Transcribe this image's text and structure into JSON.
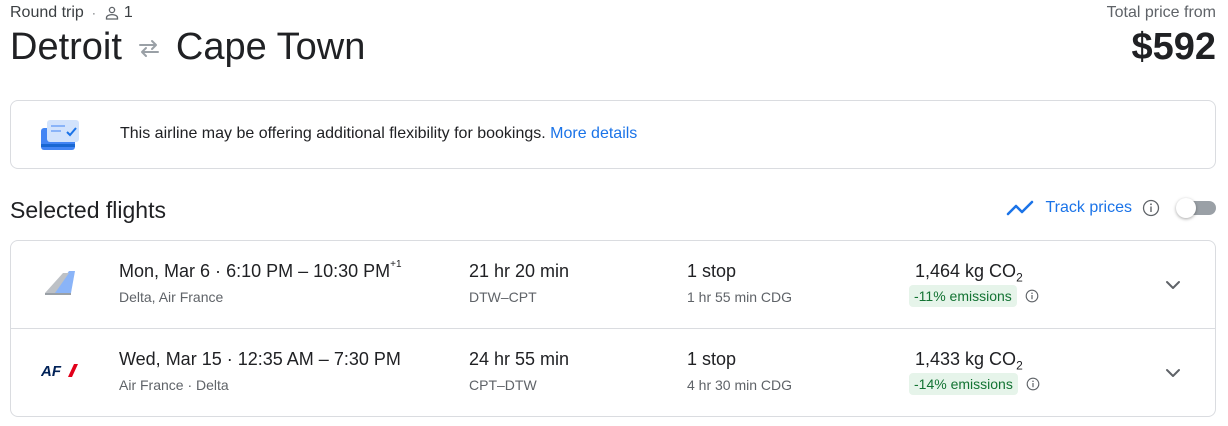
{
  "header": {
    "trip_type": "Round trip",
    "separator": "·",
    "passengers": "1",
    "origin": "Detroit",
    "destination": "Cape Town",
    "price_label": "Total price from",
    "price": "$592"
  },
  "notice": {
    "text": "This airline may be offering additional flexibility for bookings.",
    "link": "More details"
  },
  "section": {
    "title": "Selected flights",
    "track_label": "Track prices",
    "track_enabled": false
  },
  "flights": [
    {
      "date": "Mon, Mar 6",
      "dot": "·",
      "times": "6:10 PM – 10:30 PM",
      "day_offset": "+1",
      "airlines": "Delta, Air France",
      "duration": "21 hr 20 min",
      "airports": "DTW–CPT",
      "stops": "1 stop",
      "layover": "1 hr 55 min CDG",
      "co2_value": "1,464 kg CO",
      "co2_sub": "2",
      "emissions": "-11% emissions",
      "logo": "delta-logo"
    },
    {
      "date": "Wed, Mar 15",
      "dot": "·",
      "times": "12:35 AM – 7:30 PM",
      "day_offset": "",
      "airlines": "Air France · Delta",
      "duration": "24 hr 55 min",
      "airports": "CPT–DTW",
      "stops": "1 stop",
      "layover": "4 hr 30 min CDG",
      "co2_value": "1,433 kg CO",
      "co2_sub": "2",
      "emissions": "-14% emissions",
      "logo": "air-france-logo",
      "logo_text": "AF"
    }
  ],
  "colors": {
    "accent": "#1a73e8",
    "emissions_bg": "#e6f4ea",
    "emissions_text": "#137333",
    "border": "#dadce0"
  }
}
